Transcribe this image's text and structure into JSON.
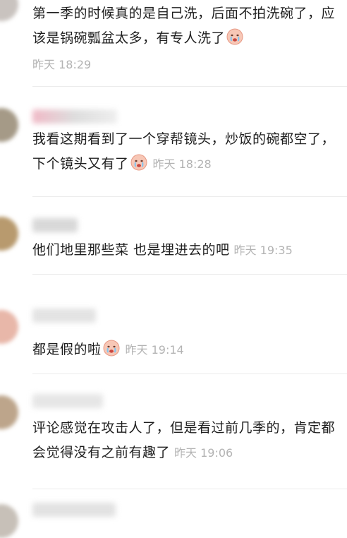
{
  "comments": [
    {
      "text": "第一季的时候真的是自己洗，后面不拍洗碗了，应该是锅碗瓢盆太多，有专人洗了",
      "emoji": "crying-face",
      "time": "昨天 18:29"
    },
    {
      "text": "我看这期看到了一个穿帮镜头，炒饭的碗都空了，下个镜头又有了",
      "emoji": "crying-face",
      "time": "昨天 18:28"
    },
    {
      "text": "他们地里那些菜 也是埋进去的吧",
      "time": "昨天 19:35"
    },
    {
      "text": "都是假的啦",
      "emoji": "crying-face",
      "time": "昨天 19:14"
    },
    {
      "text": "评论感觉在攻击人了，但是看过前几季的，肯定都会觉得没有之前有趣了",
      "time": "昨天 19:06"
    }
  ],
  "colors": {
    "time": "#b3b3b3",
    "text": "#1f1f1f",
    "divider": "#ececec"
  }
}
